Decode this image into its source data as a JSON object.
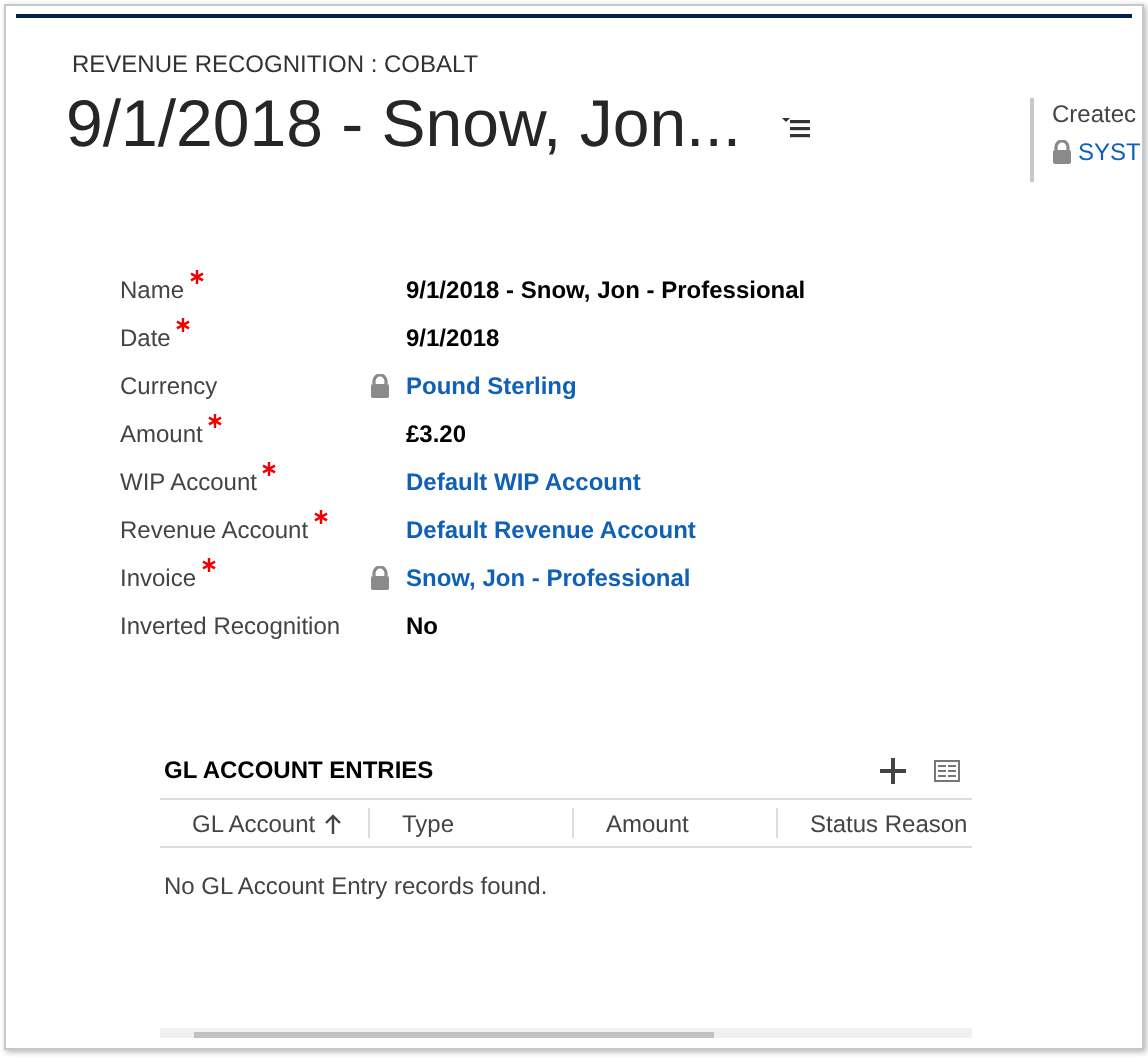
{
  "header": {
    "entity": "REVENUE RECOGNITION : COBALT",
    "title": "9/1/2018 - Snow, Jon...",
    "side_label": "Createc",
    "side_value": "SYST",
    "side_locked": true
  },
  "fields": [
    {
      "label": "Name",
      "required": true,
      "locked": false,
      "value": "9/1/2018 - Snow, Jon - Professional",
      "kind": "text"
    },
    {
      "label": "Date",
      "required": true,
      "locked": false,
      "value": "9/1/2018",
      "kind": "text"
    },
    {
      "label": "Currency",
      "required": false,
      "locked": true,
      "value": "Pound Sterling",
      "kind": "link"
    },
    {
      "label": "Amount",
      "required": true,
      "locked": false,
      "value": "£3.20",
      "kind": "text"
    },
    {
      "label": "WIP Account",
      "required": true,
      "locked": false,
      "value": "Default WIP Account",
      "kind": "link"
    },
    {
      "label": "Revenue Account",
      "required": true,
      "locked": false,
      "value": "Default Revenue Account",
      "kind": "link"
    },
    {
      "label": "Invoice",
      "required": true,
      "locked": true,
      "value": "Snow, Jon - Professional",
      "kind": "link"
    },
    {
      "label": "Inverted Recognition",
      "required": false,
      "locked": false,
      "value": "No",
      "kind": "text"
    }
  ],
  "grid": {
    "title": "GL ACCOUNT ENTRIES",
    "columns": [
      {
        "label": "GL Account",
        "sorted": true
      },
      {
        "label": "Type",
        "sorted": false
      },
      {
        "label": "Amount",
        "sorted": false
      },
      {
        "label": "Status Reason",
        "sorted": false
      }
    ],
    "empty_message": "No GL Account Entry records found."
  }
}
